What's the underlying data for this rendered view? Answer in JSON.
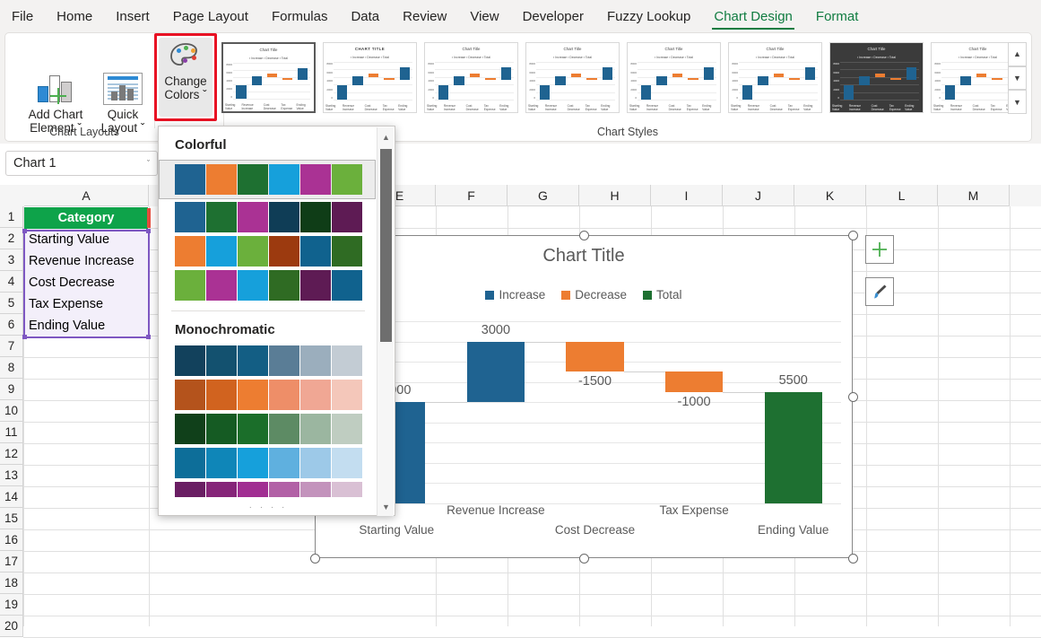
{
  "ribbon": {
    "tabs": [
      {
        "label": "File",
        "active": false
      },
      {
        "label": "Home",
        "active": false
      },
      {
        "label": "Insert",
        "active": false
      },
      {
        "label": "Page Layout",
        "active": false
      },
      {
        "label": "Formulas",
        "active": false
      },
      {
        "label": "Data",
        "active": false
      },
      {
        "label": "Review",
        "active": false
      },
      {
        "label": "View",
        "active": false
      },
      {
        "label": "Developer",
        "active": false
      },
      {
        "label": "Fuzzy Lookup",
        "active": false
      },
      {
        "label": "Chart Design",
        "active": true
      },
      {
        "label": "Format",
        "active": false
      }
    ],
    "groups": [
      {
        "label": "Chart Layouts"
      },
      {
        "label": "Chart Styles"
      }
    ],
    "buttons": {
      "add_chart_element_line1": "Add Chart",
      "add_chart_element_line2": "Element ˇ",
      "quick_layout_line1": "Quick",
      "quick_layout_line2": "Layout ˇ",
      "change_colors_line1": "Change",
      "change_colors_line2": "Colors ˇ"
    },
    "gallery_scroll": {
      "up": "▲",
      "down": "▼",
      "more": "▼"
    },
    "style_thumbnails": [
      {
        "title": "Chart Title",
        "selected": true,
        "dark": false,
        "caps": false
      },
      {
        "title": "CHART TITLE",
        "selected": false,
        "dark": false,
        "caps": true
      },
      {
        "title": "Chart Title",
        "selected": false,
        "dark": false,
        "caps": false
      },
      {
        "title": "Chart Title",
        "selected": false,
        "dark": false,
        "caps": false
      },
      {
        "title": "Chart Title",
        "selected": false,
        "dark": false,
        "caps": false
      },
      {
        "title": "Chart Title",
        "selected": false,
        "dark": false,
        "caps": false
      },
      {
        "title": "Chart Title",
        "selected": false,
        "dark": true,
        "caps": false
      },
      {
        "title": "Chart Title",
        "selected": false,
        "dark": false,
        "caps": false
      }
    ],
    "thumb_legend": "▪ Increase  ▪ Decrease  ▪ Total",
    "thumb_xlabels": [
      "Starting Value",
      "Revenue Increase",
      "Cost Decrease",
      "Tax Expense",
      "Ending Value"
    ]
  },
  "namebox": {
    "value": "Chart 1",
    "chevron": "ˇ"
  },
  "sheet": {
    "column_headers": [
      "A",
      "E",
      "F",
      "G",
      "H",
      "I",
      "J",
      "K",
      "L",
      "M"
    ],
    "row_numbers": [
      "1",
      "2",
      "3",
      "4",
      "5",
      "6",
      "7",
      "8",
      "9",
      "10",
      "11",
      "12",
      "13",
      "14",
      "15",
      "16",
      "17",
      "18",
      "19",
      "20"
    ],
    "column_a": {
      "header": "Category",
      "cells": [
        "Starting Value",
        "Revenue Increase",
        "Cost Decrease",
        "Tax Expense",
        "Ending Value"
      ]
    }
  },
  "chart_data": {
    "type": "bar",
    "title": "Chart Title",
    "subtype": "waterfall",
    "categories": [
      "Starting Value",
      "Revenue Increase",
      "Cost Decrease",
      "Tax Expense",
      "Ending Value"
    ],
    "values": [
      5000,
      3000,
      -1500,
      -1000,
      5500
    ],
    "data_labels": [
      "5000",
      "3000",
      "-1500",
      "-1000",
      "5500"
    ],
    "cumulative_start": [
      0,
      5000,
      8000,
      6500,
      0
    ],
    "cumulative_end": [
      5000,
      8000,
      6500,
      5500,
      5500
    ],
    "series": [
      {
        "name": "Increase",
        "color": "#1F6391",
        "indices": [
          0,
          1
        ]
      },
      {
        "name": "Decrease",
        "color": "#ED7D31",
        "indices": [
          2,
          3
        ]
      },
      {
        "name": "Total",
        "color": "#1E7031",
        "indices": [
          4
        ]
      }
    ],
    "legend": [
      "Increase",
      "Decrease",
      "Total"
    ],
    "legend_position": "top",
    "xlabel": "",
    "ylabel": "",
    "ylim": [
      0,
      9000
    ],
    "grid": true
  },
  "chart_buttons": {
    "elements_icon": "plus-icon",
    "styles_icon": "paintbrush-icon"
  },
  "colors_dropdown": {
    "sections": [
      {
        "title": "Colorful",
        "rows": [
          {
            "selected": true,
            "colors": [
              "#1F6391",
              "#ED7D31",
              "#1E7031",
              "#16A0DB",
              "#AA3294",
              "#6BB03C"
            ]
          },
          {
            "selected": false,
            "colors": [
              "#1F6391",
              "#1E7031",
              "#AA3294",
              "#0F3D56",
              "#0F3D17",
              "#5E1B54"
            ]
          },
          {
            "selected": false,
            "colors": [
              "#ED7D31",
              "#16A0DB",
              "#6BB03C",
              "#9C3A0F",
              "#10628E",
              "#2F6B23"
            ]
          },
          {
            "selected": false,
            "colors": [
              "#6BB03C",
              "#AA3294",
              "#16A0DB",
              "#2F6B23",
              "#5E1B54",
              "#10628E"
            ]
          }
        ]
      },
      {
        "title": "Monochromatic",
        "rows": [
          {
            "selected": false,
            "colors": [
              "#12415C",
              "#13516F",
              "#135E84",
              "#5A7D96",
              "#9BAEBD",
              "#C3CCD4"
            ]
          },
          {
            "selected": false,
            "colors": [
              "#B4531C",
              "#D1631F",
              "#ED7D31",
              "#EE8E68",
              "#F0A794",
              "#F4C7BA"
            ]
          },
          {
            "selected": false,
            "colors": [
              "#10401A",
              "#155B23",
              "#1B6E2A",
              "#5D8B64",
              "#9BB6A0",
              "#BFCDC1"
            ]
          },
          {
            "selected": false,
            "colors": [
              "#0D6E99",
              "#0F86B8",
              "#16A0DB",
              "#5FB0DF",
              "#9DC9E8",
              "#C3DDF0"
            ]
          },
          {
            "selected": false,
            "colors": [
              "#6A1E63",
              "#862579",
              "#A12E92",
              "#B261A6",
              "#C393BC",
              "#D9C0D4"
            ]
          }
        ]
      }
    ],
    "scrollbar": {
      "up": "▲",
      "down": "▼"
    },
    "grip": "· · · ·"
  },
  "theme": {
    "accent_green": "#107c41",
    "highlight_red": "#e81123",
    "selection_purple": "#7e57c2",
    "header_green": "#0ea34a"
  }
}
